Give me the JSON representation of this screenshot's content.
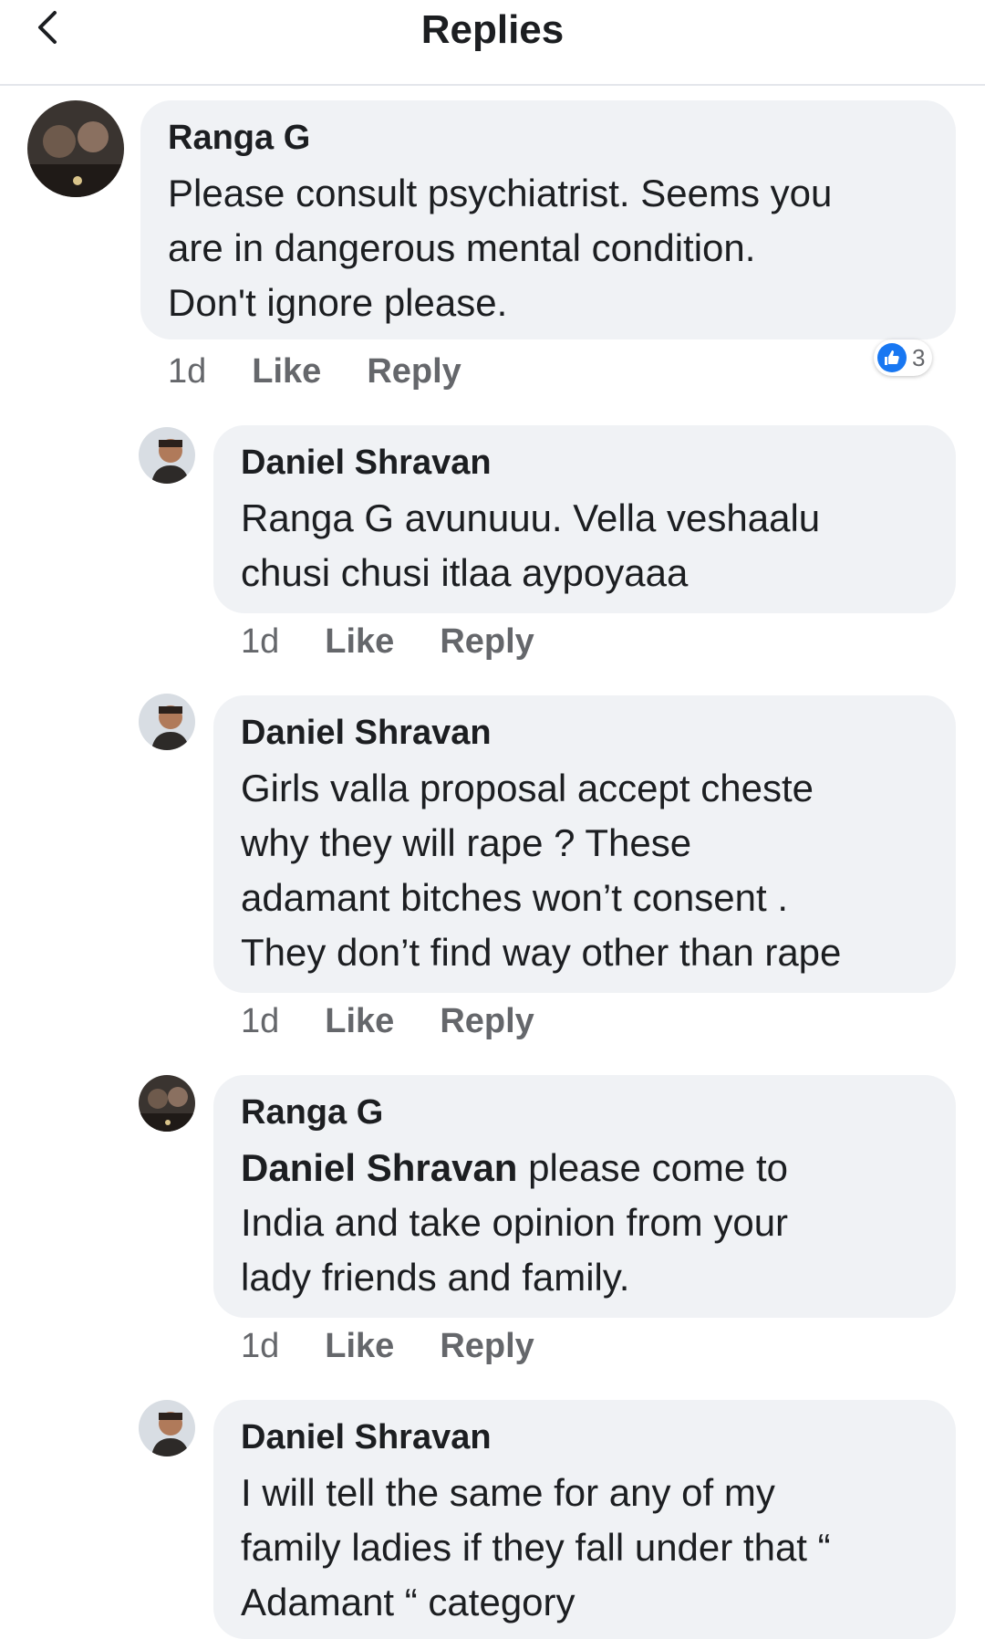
{
  "header": {
    "title": "Replies"
  },
  "comments": [
    {
      "author": "Ranga G",
      "lines": [
        "Please consult psychiatrist. Seems you",
        "are in dangerous mental condition.",
        "Don't ignore please."
      ],
      "time": "1d",
      "like": "Like",
      "reply": "Reply",
      "reactions": "3"
    },
    {
      "author": "Daniel Shravan",
      "lines": [
        "Ranga G avunuuu. Vella veshaalu",
        "chusi chusi itlaa aypoyaaa"
      ],
      "time": "1d",
      "like": "Like",
      "reply": "Reply"
    },
    {
      "author": "Daniel Shravan",
      "lines": [
        "Girls valla proposal accept cheste",
        "why they will rape ? These",
        "adamant bitches won’t consent .",
        "They don’t find way other than rape"
      ],
      "time": "1d",
      "like": "Like",
      "reply": "Reply"
    },
    {
      "author": "Ranga G",
      "mention": "Daniel Shravan",
      "lines": [
        " please come to",
        "India and take opinion from your",
        "lady friends and family."
      ],
      "time": "1d",
      "like": "Like",
      "reply": "Reply"
    },
    {
      "author": "Daniel Shravan",
      "lines": [
        "I will tell the same for any of my",
        "family ladies if they fall under that “",
        "Adamant “ category"
      ]
    }
  ],
  "colors": {
    "bubble": "#f0f2f5",
    "meta": "#65676b",
    "like_blue": "#1877f2"
  }
}
